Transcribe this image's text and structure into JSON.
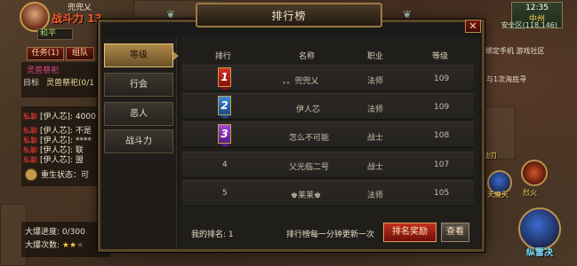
{
  "hud_left": {
    "server_name": "兜兜乂",
    "power_label": "战斗力 13",
    "pk_mode": "和平",
    "task_tab": "任务(1)",
    "team_tab": "组队",
    "quest_title": "灵兽祭祀",
    "quest_target_label": "目标",
    "quest_target": "灵兽祭祀(0/1",
    "chat": [
      {
        "tag": "私聊",
        "text": "[伊人芯]: 4000"
      },
      {
        "tag": "私聊",
        "text": "[伊人芯]: 不是"
      },
      {
        "tag": "私聊",
        "text": "[伊人芯]: ****"
      },
      {
        "tag": "私聊",
        "text": "[伊人芯]: 联"
      },
      {
        "tag": "私聊",
        "text": "[伊人芯]: 盟"
      }
    ],
    "rebirth": "重生状态：可",
    "burst_progress": "大爆进度:  0/300",
    "burst_count_label": "大爆次数:"
  },
  "hud_right": {
    "clock": "12:35",
    "zone": "中州",
    "coords": "安全区(118,146)",
    "bind_phone": "绑定手机 游戏社区",
    "promo": "与1次海底寻",
    "skill_labels": [
      "劫刃",
      "天魔灭",
      "烈火",
      "纵雷决"
    ]
  },
  "dialog": {
    "title": "排行榜",
    "tabs": [
      "等级",
      "行会",
      "恶人",
      "战斗力"
    ],
    "active_tab": 0,
    "columns": [
      "排行",
      "名称",
      "职业",
      "等级"
    ],
    "rows": [
      {
        "rank": "1",
        "name": "。。兜兜乂",
        "class": "法师",
        "level": "109"
      },
      {
        "rank": "2",
        "name": "伊人芯",
        "class": "法师",
        "level": "109"
      },
      {
        "rank": "3",
        "name": "怎么不可能",
        "class": "战士",
        "level": "108"
      },
      {
        "rank": "4",
        "name": "父光临二号",
        "class": "战士",
        "level": "107"
      },
      {
        "rank": "5",
        "name": "♚莱莱♚",
        "class": "法师",
        "level": "105"
      }
    ],
    "my_rank": "我的排名: 1",
    "update_note": "排行榜每一分钟更新一次",
    "reward_button": "排名奖励",
    "view_button": "查看",
    "close_glyph": "✕"
  }
}
